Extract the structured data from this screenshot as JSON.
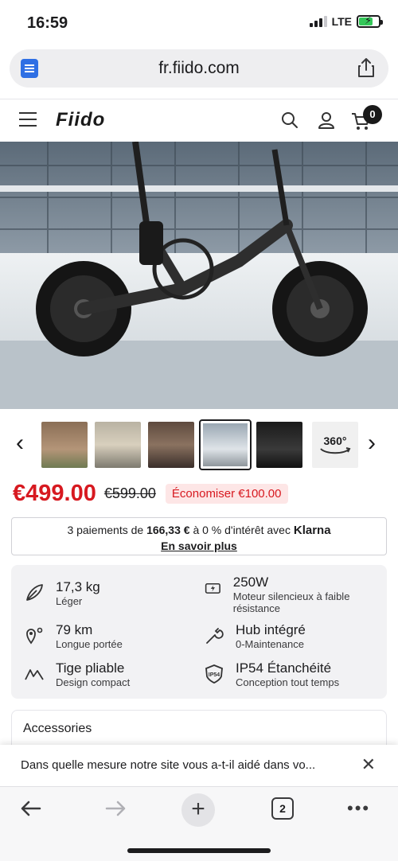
{
  "status_bar": {
    "time": "16:59",
    "network": "LTE"
  },
  "browser": {
    "url": "fr.fiido.com"
  },
  "header": {
    "logo": "Fiido",
    "cart_count": "0"
  },
  "product": {
    "price_now": "€499.00",
    "price_was": "€599.00",
    "save_label": "Économiser €100.00"
  },
  "thumbnails": {
    "badge_360": "360°"
  },
  "klarna": {
    "prefix": "3 paiements de ",
    "amount": "166,33 €",
    "suffix": " à 0 % d'intérêt avec ",
    "brand": "Klarna",
    "link": "En savoir plus"
  },
  "features": [
    {
      "title": "17,3 kg",
      "sub": "Léger",
      "icon": "feather-icon"
    },
    {
      "title": "250W",
      "sub": "Moteur silencieux à faible résistance",
      "icon": "battery-bolt-icon"
    },
    {
      "title": "79 km",
      "sub": "Longue portée",
      "icon": "route-pin-icon"
    },
    {
      "title": "Hub intégré",
      "sub": "0-Maintenance",
      "icon": "wrench-icon"
    },
    {
      "title": "Tige pliable",
      "sub": "Design compact",
      "icon": "fold-icon"
    },
    {
      "title": "IP54 Étanchéité",
      "sub": "Conception tout temps",
      "icon": "ip54-shield-icon"
    }
  ],
  "accessories": {
    "title": "Accessories"
  },
  "survey": {
    "question": "Dans quelle mesure notre site vous a-t-il aidé dans vo..."
  },
  "toolbar": {
    "tabs_count": "2"
  }
}
